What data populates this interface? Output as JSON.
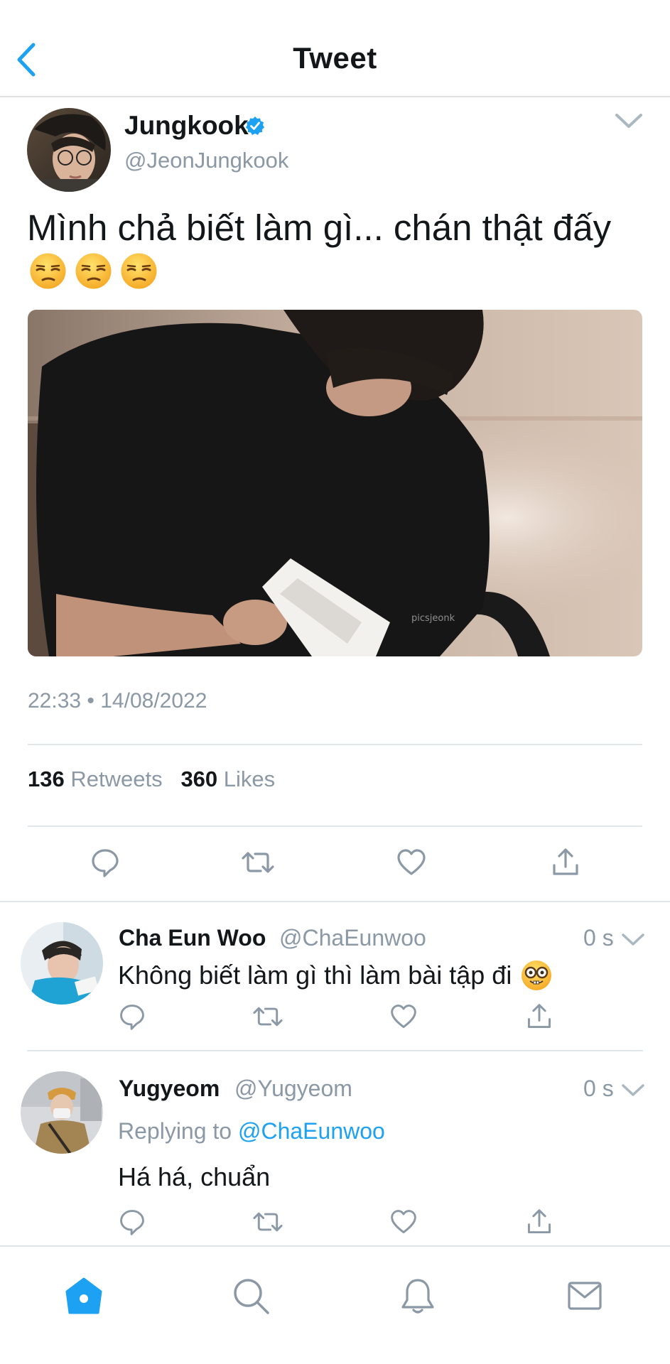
{
  "header": {
    "title": "Tweet",
    "back_icon": "chevron-left-icon"
  },
  "colors": {
    "accent": "#1da1f2",
    "muted": "#8b98a5",
    "text": "#14171a",
    "divider": "#e1e6ea"
  },
  "tweet": {
    "author_name": "Jungkook",
    "author_handle": "@JeonJungkook",
    "verified": true,
    "text": "Mình chả biết làm gì... chán thật đấy",
    "emojis": [
      "unamused-face",
      "unamused-face",
      "unamused-face"
    ],
    "image_watermark": "picsjeonk",
    "timestamp": "22:33 • 14/08/2022",
    "retweets_count": "136",
    "retweets_label": "Retweets",
    "likes_count": "360",
    "likes_label": "Likes"
  },
  "replies": [
    {
      "name": "Cha Eun Woo",
      "handle": "@ChaEunwoo",
      "time": "0 s",
      "text": "Không biết làm gì thì làm bài tập đi",
      "emoji": "nerd-face"
    },
    {
      "name": "Yugyeom",
      "handle": "@Yugyeom",
      "time": "0 s",
      "replying_prefix": "Replying to",
      "replying_to": "@ChaEunwoo",
      "text": "Há há, chuẩn"
    }
  ],
  "tabbar": {
    "items": [
      "home-icon",
      "search-icon",
      "bell-icon",
      "mail-icon"
    ],
    "active": "home-icon"
  }
}
